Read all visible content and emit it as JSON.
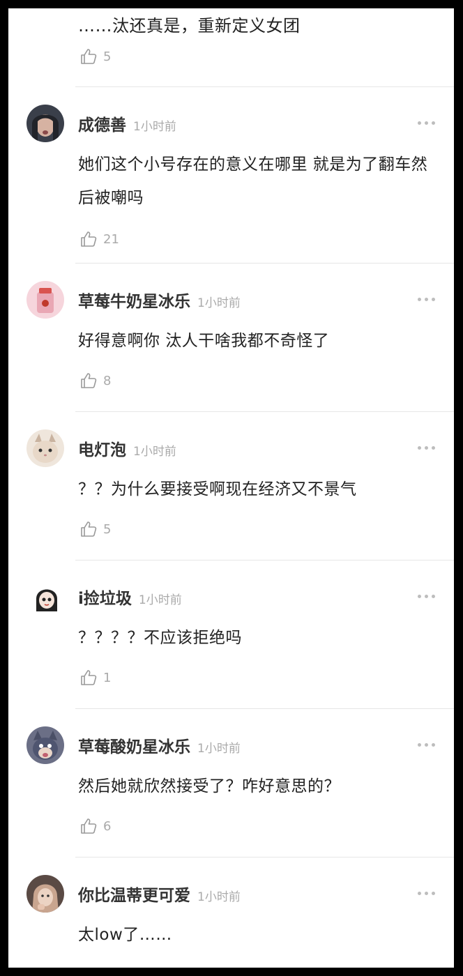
{
  "partial_comment": {
    "text": "……汰还真是，重新定义女团",
    "likes": "5"
  },
  "comments": [
    {
      "username": "成德善",
      "time": "1小时前",
      "text": "她们这个小号存在的意义在哪里 就是为了翻车然后被嘲吗",
      "likes": "21",
      "avatar_colors": [
        "#3a3f4a",
        "#c9a89a"
      ]
    },
    {
      "username": "草莓牛奶星冰乐",
      "time": "1小时前",
      "text": "好得意啊你  汰人干啥我都不奇怪了",
      "likes": "8",
      "avatar_colors": [
        "#f3c8d2",
        "#d9534f"
      ]
    },
    {
      "username": "电灯泡",
      "time": "1小时前",
      "text": "？？为什么要接受啊现在经济又不景气",
      "likes": "5",
      "avatar_colors": [
        "#e8dcd0",
        "#b39a85"
      ]
    },
    {
      "username": "i捡垃圾",
      "time": "1小时前",
      "text": "？？？？不应该拒绝吗",
      "likes": "1",
      "avatar_colors": [
        "#ffffff",
        "#222222"
      ]
    },
    {
      "username": "草莓酸奶星冰乐",
      "time": "1小时前",
      "text": "然后她就欣然接受了？咋好意思的？",
      "likes": "6",
      "avatar_colors": [
        "#4a4f66",
        "#c08a8a"
      ]
    },
    {
      "username": "你比温蒂更可爱",
      "time": "1小时前",
      "text": "太low了……",
      "likes": "",
      "avatar_colors": [
        "#6b5a52",
        "#d7b8a6"
      ]
    }
  ],
  "icons": {
    "like": "thumbs-up-icon",
    "more": "more-icon"
  },
  "colors": {
    "text": "#222222",
    "username": "#333333",
    "muted": "#aaaaaa",
    "divider": "#e6e6e6",
    "background": "#ffffff"
  }
}
